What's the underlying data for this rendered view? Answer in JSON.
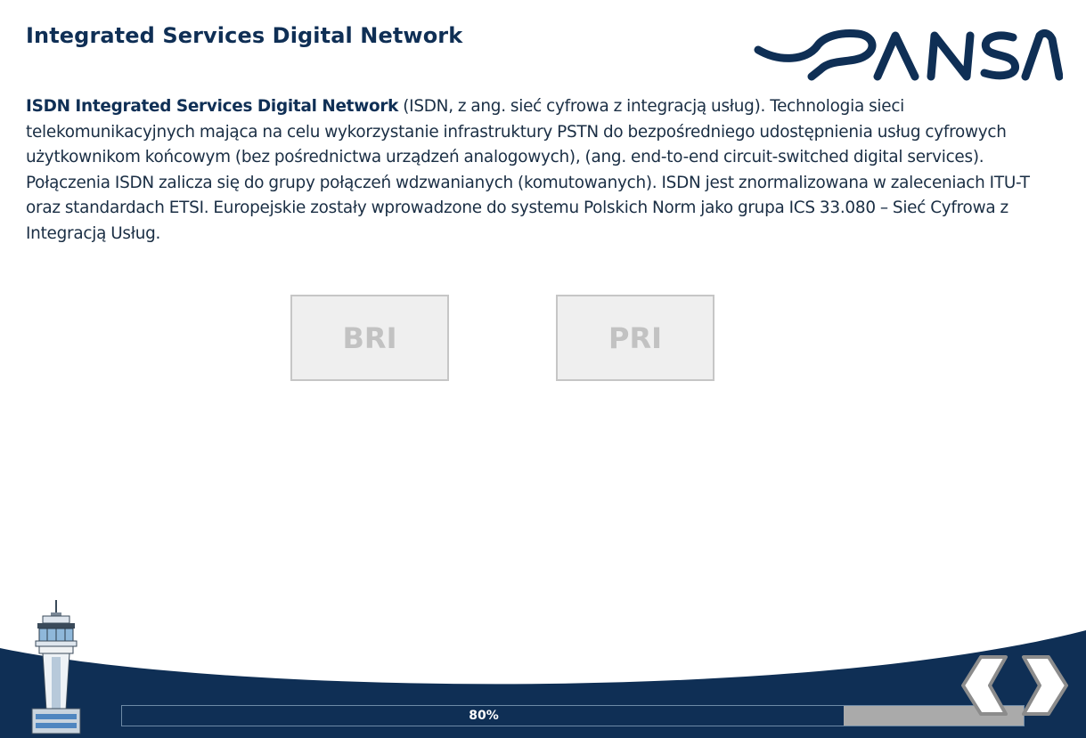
{
  "page": {
    "title": "Integrated Services Digital Network",
    "logo_text": "PANSA"
  },
  "content": {
    "lead": "ISDN Integrated Services Digital Network",
    "text": " (ISDN, z ang. sieć cyfrowa z integracją usług). Technologia sieci telekomunikacyjnych mająca na celu wykorzystanie infrastruktury PSTN do bezpośredniego udostępnienia usług cyfrowych użytkownikom końcowym (bez pośrednictwa urządzeń analogowych), (ang. end-to-end circuit-switched digital services). Połączenia ISDN zalicza się do grupy połączeń wdzwanianych (komutowanych). ISDN jest znormalizowana w zaleceniach ITU-T oraz standardach ETSI. Europejskie zostały wprowadzone do systemu Polskich Norm jako grupa ICS 33.080 – Sieć Cyfrowa z Integracją Usług."
  },
  "buttons": {
    "bri": "BRI",
    "pri": "PRI"
  },
  "progress": {
    "value": 0.8,
    "label": "80%"
  },
  "nav": {
    "prev_icon": "chevron-left-icon",
    "next_icon": "chevron-right-icon"
  },
  "colors": {
    "brand_navy": "#0f2f55",
    "button_bg": "#efefef",
    "button_text": "#c2c2c2",
    "progress_rest": "#aaaaaa"
  }
}
